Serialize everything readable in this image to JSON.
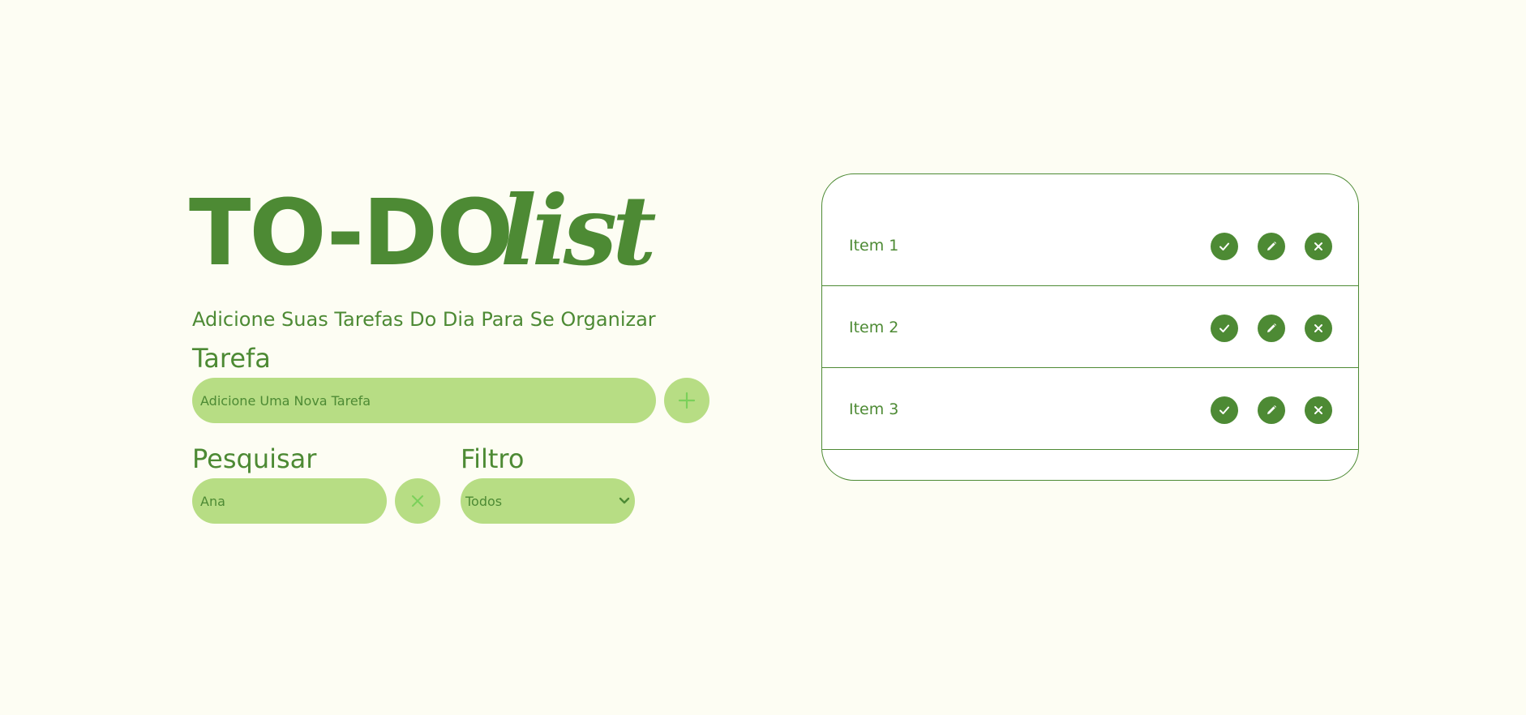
{
  "header": {
    "title_main": "TO-DO",
    "title_script": "list",
    "subtitle": "Adicione Suas Tarefas Do Dia Para Se Organizar"
  },
  "task_form": {
    "label": "Tarefa",
    "placeholder": "Adicione Uma Nova Tarefa",
    "value": "",
    "add_icon": "plus-icon"
  },
  "search": {
    "label": "Pesquisar",
    "value": "Ana",
    "clear_icon": "close-icon"
  },
  "filter": {
    "label": "Filtro",
    "selected": "Todos",
    "icon": "chevron-down-icon"
  },
  "todo_list": {
    "items": [
      {
        "text": "Item 1"
      },
      {
        "text": "Item 2"
      },
      {
        "text": "Item 3"
      }
    ],
    "action_icons": [
      "check-icon",
      "pencil-icon",
      "close-icon"
    ]
  },
  "colors": {
    "background": "#fdfdf3",
    "primary": "#4d8a34",
    "input_fill": "#b7dd84",
    "icon_light": "#7bd05a",
    "card": "#ffffff"
  }
}
